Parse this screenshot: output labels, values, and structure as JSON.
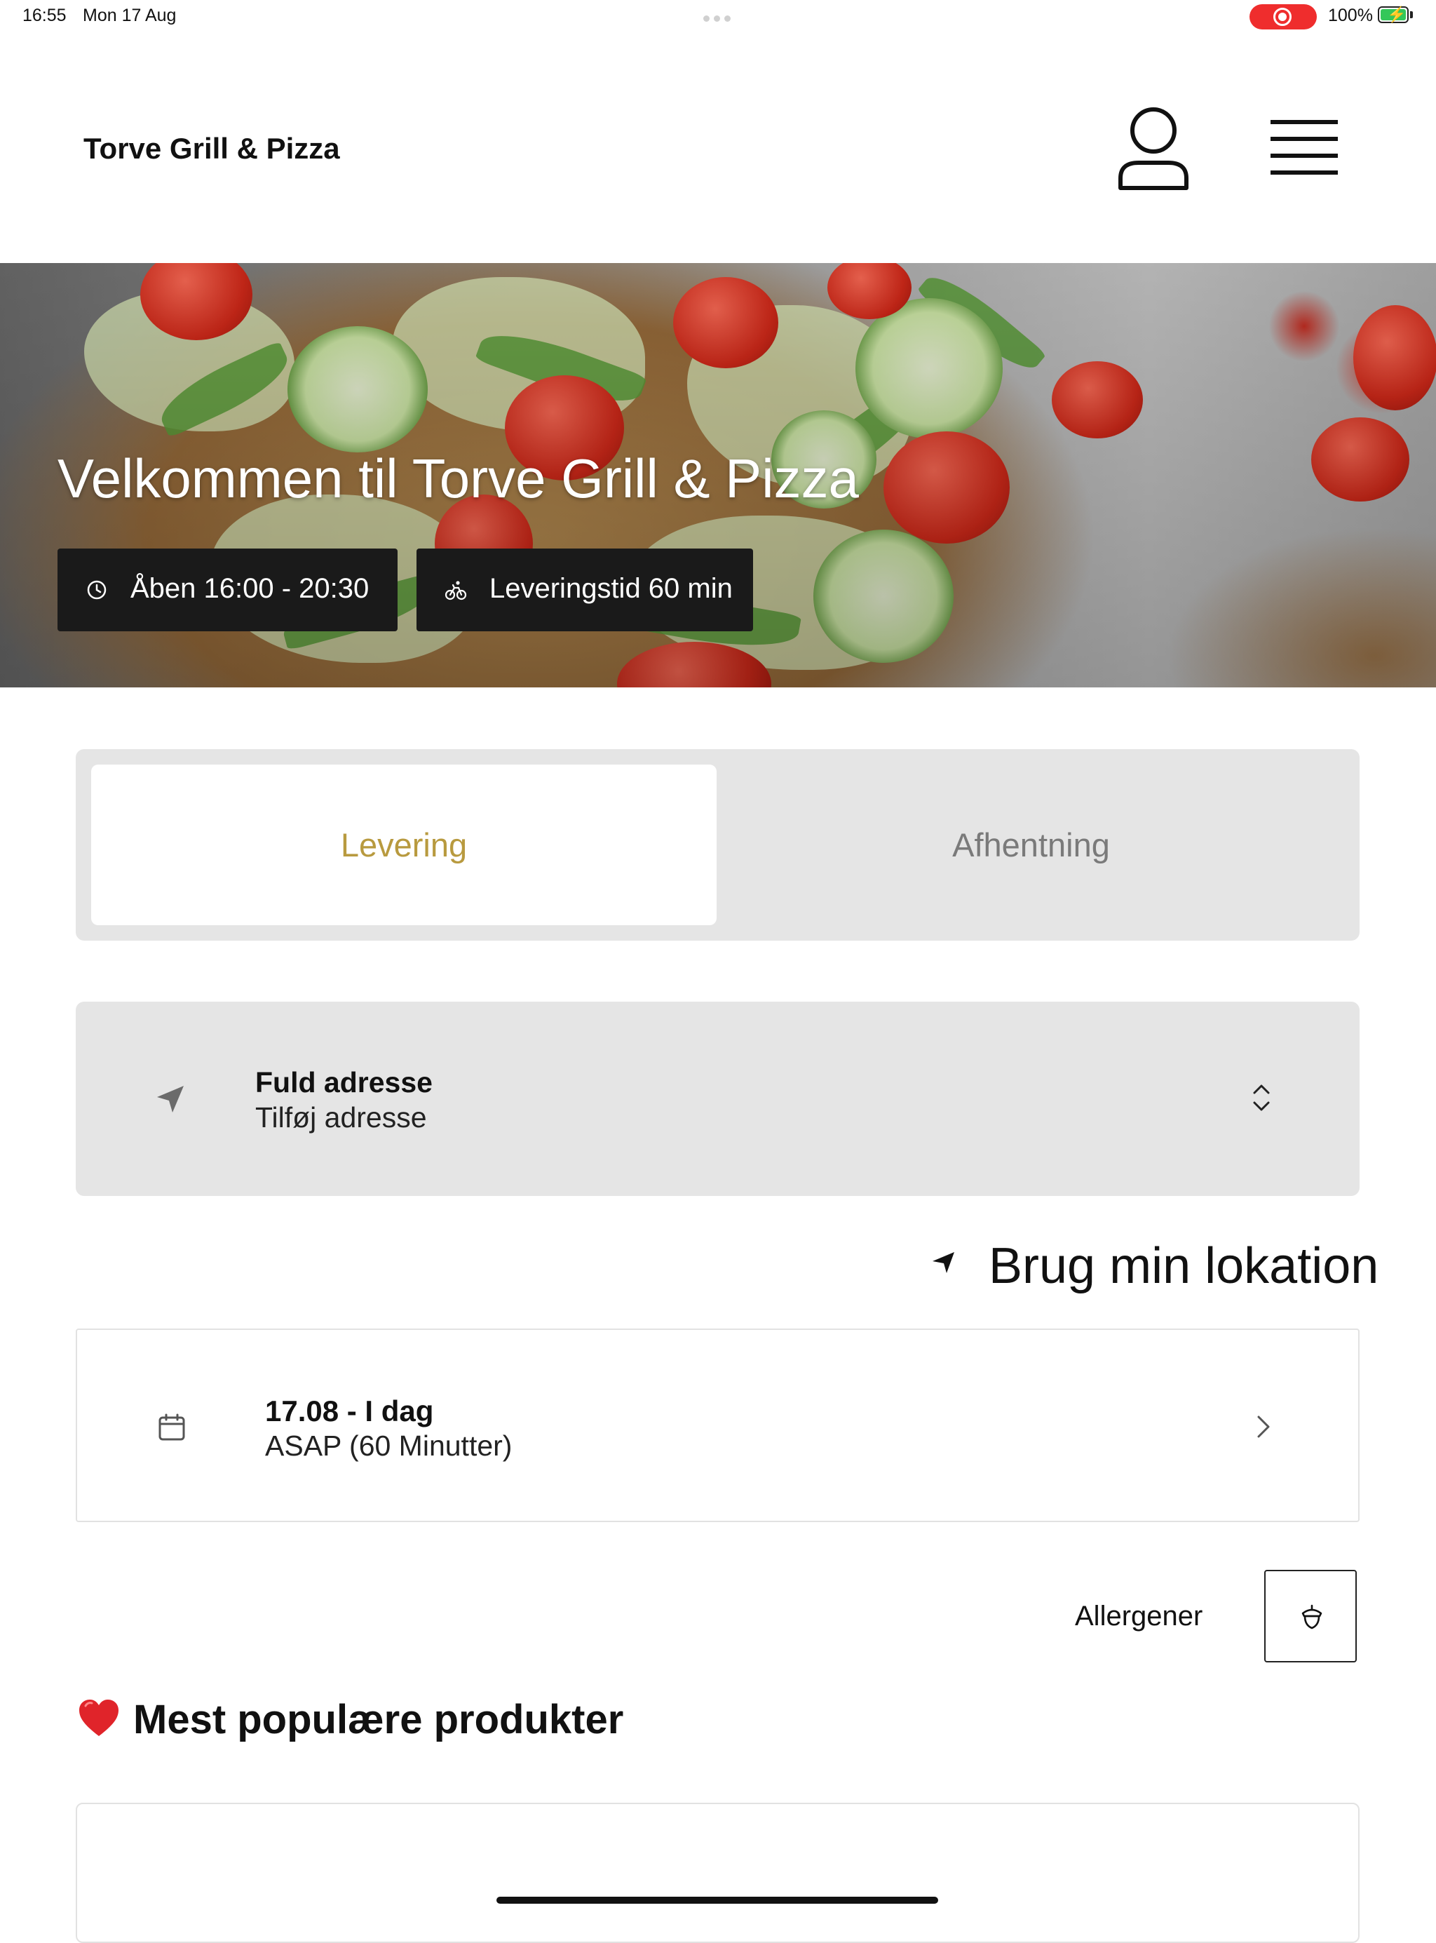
{
  "status_bar": {
    "time": "16:55",
    "date": "Mon 17 Aug",
    "battery_percent": "100%",
    "recording": true
  },
  "header": {
    "brand": "Torve Grill & Pizza",
    "icons": [
      "user-icon",
      "hamburger-menu-icon"
    ]
  },
  "hero": {
    "title": "Velkommen til Torve Grill & Pizza",
    "opening_hours": "Åben 16:00 - 20:30",
    "delivery_time": "Leveringstid 60 min"
  },
  "order_mode": {
    "options": [
      "Levering",
      "Afhentning"
    ],
    "selected": "Levering",
    "active_color": "#b89a3f"
  },
  "address": {
    "title": "Fuld adresse",
    "placeholder": "Tilføj adresse"
  },
  "use_location": {
    "label": "Brug min lokation"
  },
  "delivery_date": {
    "date": "17.08 - I dag",
    "time": "ASAP (60 Minutter)"
  },
  "allergens": {
    "label": "Allergener"
  },
  "popular": {
    "title": "Mest populære produkter"
  }
}
